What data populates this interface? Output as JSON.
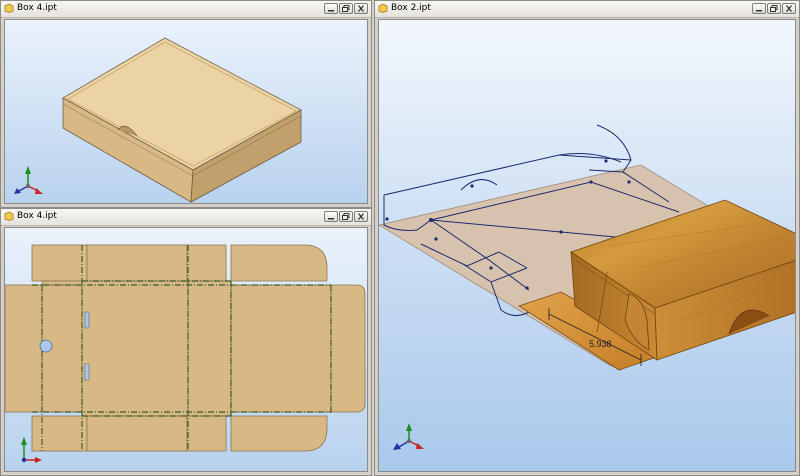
{
  "windows": {
    "top_left": {
      "title": "Box 4.ipt"
    },
    "bottom_left": {
      "title": "Box 4.ipt"
    },
    "right": {
      "title": "Box 2.ipt"
    }
  },
  "annotations": {
    "dimension_value": "5.938"
  },
  "colors": {
    "viewport_top": "#eaf2fb",
    "viewport_bottom": "#b8d2ee",
    "box_face": "#e8cc98",
    "flat_pattern": "#d8b985",
    "bend_lines": "#3c5a2a",
    "sketch_lines": "#1c2a6e",
    "wood": "#c98b2c"
  },
  "icons": [
    "part-file-icon",
    "minimize-icon",
    "restore-icon",
    "close-icon",
    "view-triad-icon"
  ]
}
